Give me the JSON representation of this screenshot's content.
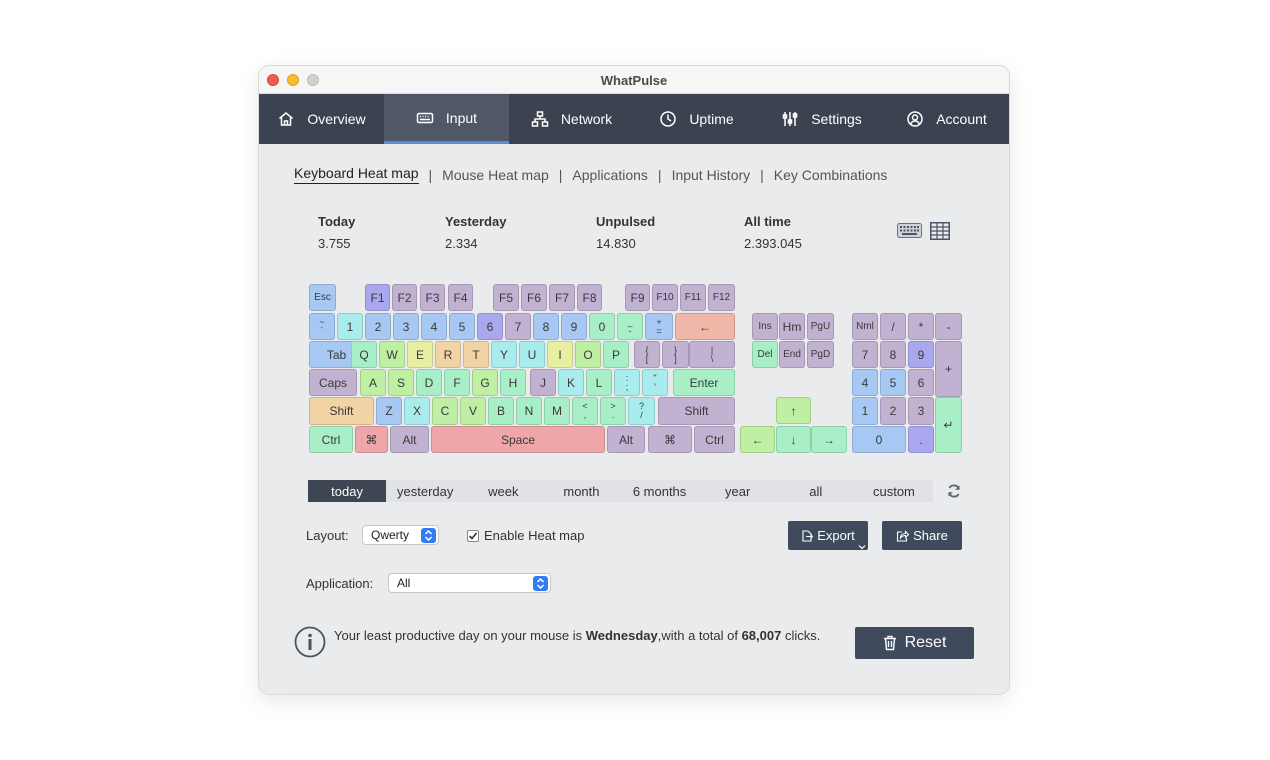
{
  "window": {
    "title": "WhatPulse"
  },
  "nav": {
    "tabs": [
      {
        "label": "Overview",
        "icon": "home-icon"
      },
      {
        "label": "Input",
        "icon": "keyboard-icon"
      },
      {
        "label": "Network",
        "icon": "network-icon"
      },
      {
        "label": "Uptime",
        "icon": "clock-icon"
      },
      {
        "label": "Settings",
        "icon": "sliders-icon"
      },
      {
        "label": "Account",
        "icon": "user-circle-icon"
      }
    ],
    "active": "Input"
  },
  "subnav": {
    "items": [
      "Keyboard Heat map",
      "Mouse Heat map",
      "Applications",
      "Input History",
      "Key Combinations"
    ],
    "separator": "|",
    "active": "Keyboard Heat map"
  },
  "stats": [
    {
      "label": "Today",
      "value": "3.755"
    },
    {
      "label": "Yesterday",
      "value": "2.334"
    },
    {
      "label": "Unpulsed",
      "value": "14.830"
    },
    {
      "label": "All time",
      "value": "2.393.045"
    }
  ],
  "heat_colors": {
    "1": "#a9a8ef",
    "2": "#b3b3d6",
    "3": "#c1b2d2",
    "4": "#a7c8f3",
    "5": "#a8ecee",
    "6": "#a8efc8",
    "7": "#bfefa3",
    "8": "#e9efa0",
    "9": "#f1d3a5",
    "10": "#f0b6a7",
    "11": "#eea6a8"
  },
  "keyboard": {
    "keys": [
      {
        "id": "esc",
        "label": "Esc",
        "heat": 4
      },
      {
        "id": "f1",
        "label": "F1",
        "heat": 1
      },
      {
        "id": "f2",
        "label": "F2",
        "heat": 3
      },
      {
        "id": "f3",
        "label": "F3",
        "heat": 3
      },
      {
        "id": "f4",
        "label": "F4",
        "heat": 3
      },
      {
        "id": "f5",
        "label": "F5",
        "heat": 3
      },
      {
        "id": "f6",
        "label": "F6",
        "heat": 3
      },
      {
        "id": "f7",
        "label": "F7",
        "heat": 3
      },
      {
        "id": "f8",
        "label": "F8",
        "heat": 3
      },
      {
        "id": "f9",
        "label": "F9",
        "heat": 3
      },
      {
        "id": "f10",
        "label": "F10",
        "heat": 3
      },
      {
        "id": "f11",
        "label": "F11",
        "heat": 3
      },
      {
        "id": "f12",
        "label": "F12",
        "heat": 3
      },
      {
        "id": "backtick",
        "label": "`",
        "shift": "~",
        "heat": 4
      },
      {
        "id": "d1",
        "label": "1",
        "heat": 5
      },
      {
        "id": "d2",
        "label": "2",
        "heat": 4
      },
      {
        "id": "d3",
        "label": "3",
        "heat": 4
      },
      {
        "id": "d4",
        "label": "4",
        "heat": 4
      },
      {
        "id": "d5",
        "label": "5",
        "heat": 4
      },
      {
        "id": "d6",
        "label": "6",
        "heat": 1
      },
      {
        "id": "d7",
        "label": "7",
        "heat": 3
      },
      {
        "id": "d8",
        "label": "8",
        "heat": 4
      },
      {
        "id": "d9",
        "label": "9",
        "heat": 4
      },
      {
        "id": "d0",
        "label": "0",
        "heat": 6
      },
      {
        "id": "minus",
        "label": "-",
        "shift": "_",
        "heat": 6
      },
      {
        "id": "equals",
        "label": "=",
        "shift": "+",
        "heat": 4
      },
      {
        "id": "backspace",
        "label": "←",
        "heat": 10
      },
      {
        "id": "tab",
        "label": "Tab",
        "heat": 4
      },
      {
        "id": "q",
        "label": "Q",
        "heat": 6
      },
      {
        "id": "w",
        "label": "W",
        "heat": 7
      },
      {
        "id": "e",
        "label": "E",
        "heat": 8
      },
      {
        "id": "r",
        "label": "R",
        "heat": 9
      },
      {
        "id": "t",
        "label": "T",
        "heat": 9
      },
      {
        "id": "y",
        "label": "Y",
        "heat": 5
      },
      {
        "id": "u",
        "label": "U",
        "heat": 5
      },
      {
        "id": "i",
        "label": "I",
        "heat": 8
      },
      {
        "id": "o",
        "label": "O",
        "heat": 7
      },
      {
        "id": "p",
        "label": "P",
        "heat": 6
      },
      {
        "id": "lbracket",
        "label": "[",
        "shift": "{",
        "heat": 3
      },
      {
        "id": "rbracket",
        "label": "]",
        "shift": "}",
        "heat": 3
      },
      {
        "id": "backslash",
        "label": "\\",
        "shift": "|",
        "heat": 3
      },
      {
        "id": "caps",
        "label": "Caps",
        "heat": 3
      },
      {
        "id": "a",
        "label": "A",
        "heat": 7
      },
      {
        "id": "s",
        "label": "S",
        "heat": 7
      },
      {
        "id": "d",
        "label": "D",
        "heat": 6
      },
      {
        "id": "f",
        "label": "F",
        "heat": 6
      },
      {
        "id": "g",
        "label": "G",
        "heat": 7
      },
      {
        "id": "h",
        "label": "H",
        "heat": 6
      },
      {
        "id": "j",
        "label": "J",
        "heat": 3
      },
      {
        "id": "k",
        "label": "K",
        "heat": 5
      },
      {
        "id": "l",
        "label": "L",
        "heat": 6
      },
      {
        "id": "semicolon",
        "label": ";",
        "shift": ":",
        "heat": 5
      },
      {
        "id": "quote",
        "label": "'",
        "shift": "\"",
        "heat": 5
      },
      {
        "id": "enter",
        "label": "Enter",
        "heat": 6
      },
      {
        "id": "lshift",
        "label": "Shift",
        "heat": 9
      },
      {
        "id": "z",
        "label": "Z",
        "heat": 4
      },
      {
        "id": "x",
        "label": "X",
        "heat": 5
      },
      {
        "id": "c",
        "label": "C",
        "heat": 7
      },
      {
        "id": "v",
        "label": "V",
        "heat": 7
      },
      {
        "id": "b",
        "label": "B",
        "heat": 6
      },
      {
        "id": "n",
        "label": "N",
        "heat": 6
      },
      {
        "id": "m",
        "label": "M",
        "heat": 6
      },
      {
        "id": "comma",
        "label": ",",
        "shift": "<",
        "heat": 6
      },
      {
        "id": "period",
        "label": ".",
        "shift": ">",
        "heat": 6
      },
      {
        "id": "slash",
        "label": "/",
        "shift": "?",
        "heat": 5
      },
      {
        "id": "rshift",
        "label": "Shift",
        "heat": 3
      },
      {
        "id": "lctrl",
        "label": "Ctrl",
        "heat": 6
      },
      {
        "id": "lcmd",
        "label": "⌘",
        "heat": 11
      },
      {
        "id": "lalt",
        "label": "Alt",
        "heat": 3
      },
      {
        "id": "space",
        "label": "Space",
        "heat": 11
      },
      {
        "id": "ralt",
        "label": "Alt",
        "heat": 3
      },
      {
        "id": "rcmd",
        "label": "⌘",
        "heat": 3
      },
      {
        "id": "rctrl",
        "label": "Ctrl",
        "heat": 3
      },
      {
        "id": "ins",
        "label": "Ins",
        "heat": 3
      },
      {
        "id": "home",
        "label": "Hm",
        "heat": 3
      },
      {
        "id": "pgup",
        "label": "PgU",
        "heat": 3
      },
      {
        "id": "del",
        "label": "Del",
        "heat": 6
      },
      {
        "id": "end",
        "label": "End",
        "heat": 3
      },
      {
        "id": "pgdn",
        "label": "PgD",
        "heat": 3
      },
      {
        "id": "up",
        "label": "↑",
        "heat": 7
      },
      {
        "id": "left",
        "label": "←",
        "heat": 7
      },
      {
        "id": "down",
        "label": "↓",
        "heat": 6
      },
      {
        "id": "right",
        "label": "→",
        "heat": 6
      },
      {
        "id": "numlock",
        "label": "Nml",
        "heat": 3
      },
      {
        "id": "kpdiv",
        "label": "/",
        "heat": 3
      },
      {
        "id": "kpmul",
        "label": "*",
        "heat": 3
      },
      {
        "id": "kpminus",
        "label": "-",
        "heat": 3
      },
      {
        "id": "kp7",
        "label": "7",
        "heat": 3
      },
      {
        "id": "kp8",
        "label": "8",
        "heat": 3
      },
      {
        "id": "kp9",
        "label": "9",
        "heat": 1
      },
      {
        "id": "kpplus",
        "label": "+",
        "heat": 3
      },
      {
        "id": "kp4",
        "label": "4",
        "heat": 4
      },
      {
        "id": "kp5",
        "label": "5",
        "heat": 4
      },
      {
        "id": "kp6",
        "label": "6",
        "heat": 3
      },
      {
        "id": "kp1",
        "label": "1",
        "heat": 4
      },
      {
        "id": "kp2",
        "label": "2",
        "heat": 3
      },
      {
        "id": "kp3",
        "label": "3",
        "heat": 3
      },
      {
        "id": "kpenter",
        "label": "↵",
        "heat": 6
      },
      {
        "id": "kp0",
        "label": "0",
        "heat": 4
      },
      {
        "id": "kpdot",
        "label": ".",
        "heat": 1
      }
    ]
  },
  "range": {
    "options": [
      "today",
      "yesterday",
      "week",
      "month",
      "6 months",
      "year",
      "all",
      "custom"
    ],
    "active": "today"
  },
  "controls": {
    "layout_label": "Layout:",
    "layout_value": "Qwerty",
    "enable_heatmap_label": "Enable Heat map",
    "enable_heatmap_checked": true,
    "export_label": "Export",
    "share_label": "Share",
    "application_label": "Application:",
    "application_value": "All"
  },
  "info": {
    "text_before": "Your least productive day on your mouse is ",
    "day": "Wednesday",
    "text_middle": ",with a total of ",
    "count": "68,007",
    "text_after": " clicks."
  },
  "reset_label": "Reset",
  "colors": {
    "nav_bg": "#3b4250",
    "nav_active": "#505868",
    "button_bg": "#3f4a5c",
    "accent": "#5b8ad6"
  }
}
